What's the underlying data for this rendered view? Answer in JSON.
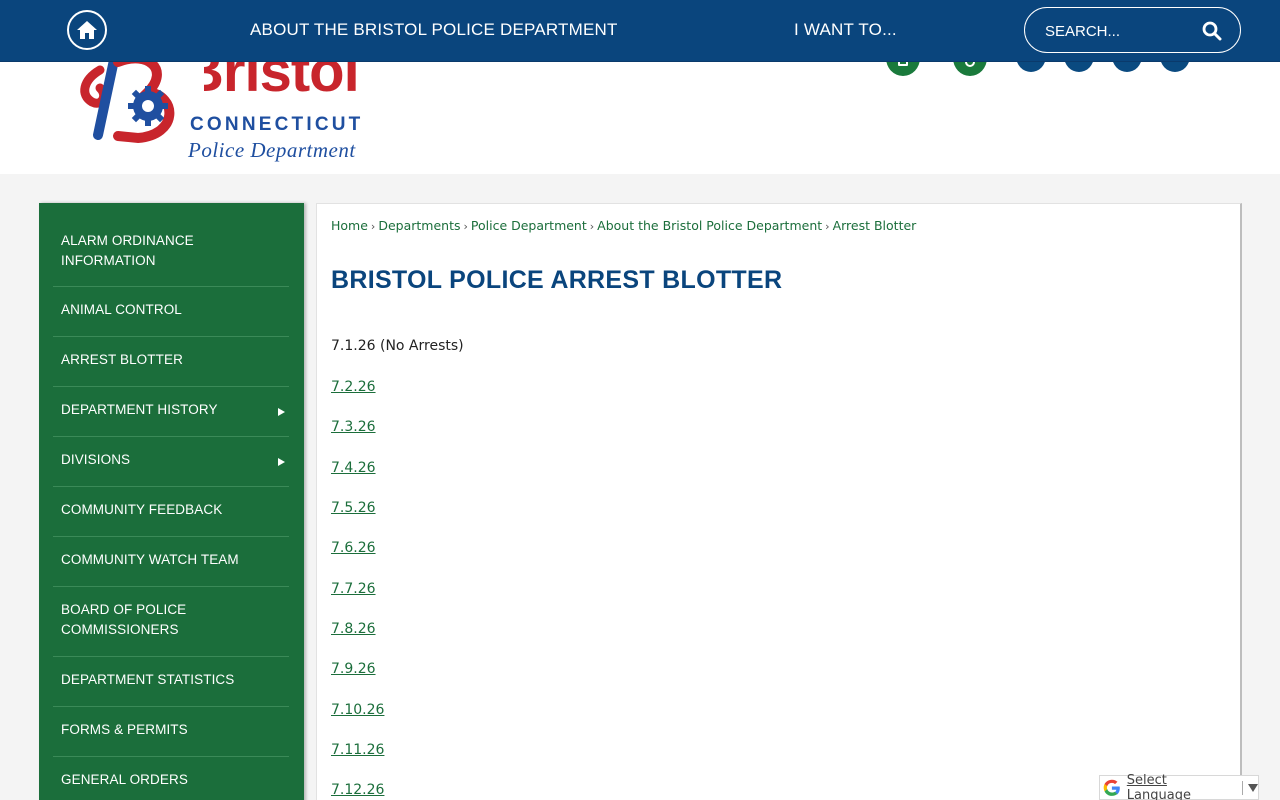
{
  "header": {
    "home_icon": "home-icon",
    "nav": [
      {
        "label": "ABOUT THE BRISTOL POLICE DEPARTMENT"
      },
      {
        "label": "I WANT TO..."
      }
    ],
    "search": {
      "placeholder": "SEARCH...",
      "icon": "search-icon"
    },
    "colors": {
      "nav_bg": "#0a457d",
      "accent_green": "#1b6e3b"
    }
  },
  "logo": {
    "wordmark": "Bristol",
    "state": "CONNECTICUT",
    "subtitle": "Police Department"
  },
  "sidebar": {
    "items": [
      {
        "label": "ALARM ORDINANCE INFORMATION",
        "has_submenu": false
      },
      {
        "label": "ANIMAL CONTROL",
        "has_submenu": false
      },
      {
        "label": "ARREST BLOTTER",
        "has_submenu": false
      },
      {
        "label": "DEPARTMENT HISTORY",
        "has_submenu": true
      },
      {
        "label": "DIVISIONS",
        "has_submenu": true
      },
      {
        "label": "COMMUNITY FEEDBACK",
        "has_submenu": false
      },
      {
        "label": "COMMUNITY WATCH TEAM",
        "has_submenu": false
      },
      {
        "label": "BOARD OF POLICE COMMISSIONERS",
        "has_submenu": false
      },
      {
        "label": "DEPARTMENT STATISTICS",
        "has_submenu": false
      },
      {
        "label": "FORMS & PERMITS",
        "has_submenu": false
      },
      {
        "label": "GENERAL ORDERS",
        "has_submenu": false
      }
    ]
  },
  "breadcrumb": [
    "Home",
    "Departments",
    "Police Department",
    "About the Bristol Police Department",
    "Arrest Blotter"
  ],
  "main": {
    "title": "BRISTOL POLICE ARREST BLOTTER",
    "first_entry": "7.1.26 (No Arrests)",
    "links": [
      "7.2.26",
      "7.3.26",
      "7.4.26",
      "7.5.26",
      "7.6.26",
      "7.7.26",
      "7.8.26",
      "7.9.26",
      "7.10.26",
      "7.11.26",
      "7.12.26"
    ]
  },
  "translate": {
    "label": "Select Language",
    "icon": "google-icon"
  }
}
